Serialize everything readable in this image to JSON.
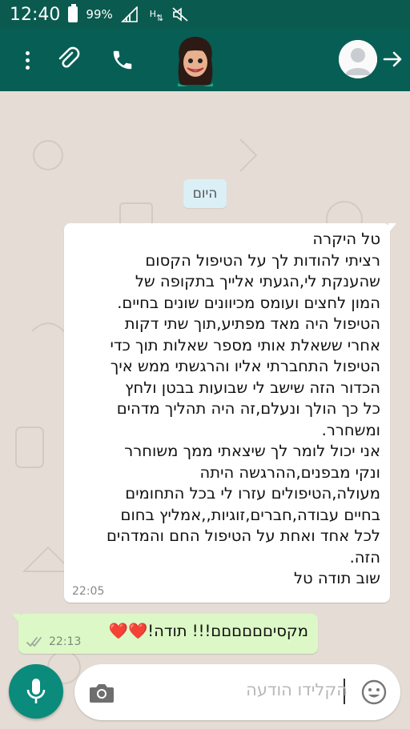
{
  "status_bar": {
    "time": "12:40",
    "battery_percent": "99%",
    "network": "H"
  },
  "header": {
    "icons": [
      "menu-icon",
      "attach-icon",
      "call-icon",
      "avatar-emoji",
      "profile-avatar",
      "forward-icon"
    ]
  },
  "chat": {
    "date_chip": "היום",
    "incoming_message": {
      "text": "טל היקרה\nרציתי להודות לך על הטיפול הקסום\nשהענקת לי,הגעתי אלייך בתקופה של\nהמון לחצים ועומס מכיוונים שונים בחיים.\nהטיפול היה מאד מפתיע,תוך שתי דקות\nאחרי ששאלת אותי מספר שאלות תוך כדי\nהטיפול התחברתי אליו והרגשתי ממש איך\nהכדור הזה שישב לי שבועות בבטן ולחץ\nכל כך הולך ונעלם,זה היה תהליך מדהים\nומשחרר.\nאני יכול לומר לך שיצאתי ממך משוחרר\nונקי מבפנים,ההרגשה היתה\nמעולה,הטיפולים עזרו לי בכל התחומים\nבחיים עבודה,חברים,זוגיות,,אמליץ בחום\nלכל אחד ואחת על הטיפול החם והמדהים\nהזה.\nשוב תודה טל",
      "time": "22:05"
    },
    "outgoing_message": {
      "text": "מקסיםםםםםם!!! תודה!❤️❤️",
      "time": "22:13",
      "status": "read"
    }
  },
  "composer": {
    "placeholder": "הקלידו הודעה"
  },
  "colors": {
    "header": "#075e54",
    "status_bar": "#0b5a4f",
    "wallpaper": "#e5ddd5",
    "outgoing_bubble": "#dcf8c6",
    "incoming_bubble": "#ffffff",
    "mic_button": "#0a8b7c",
    "date_chip": "#dbeff6"
  }
}
